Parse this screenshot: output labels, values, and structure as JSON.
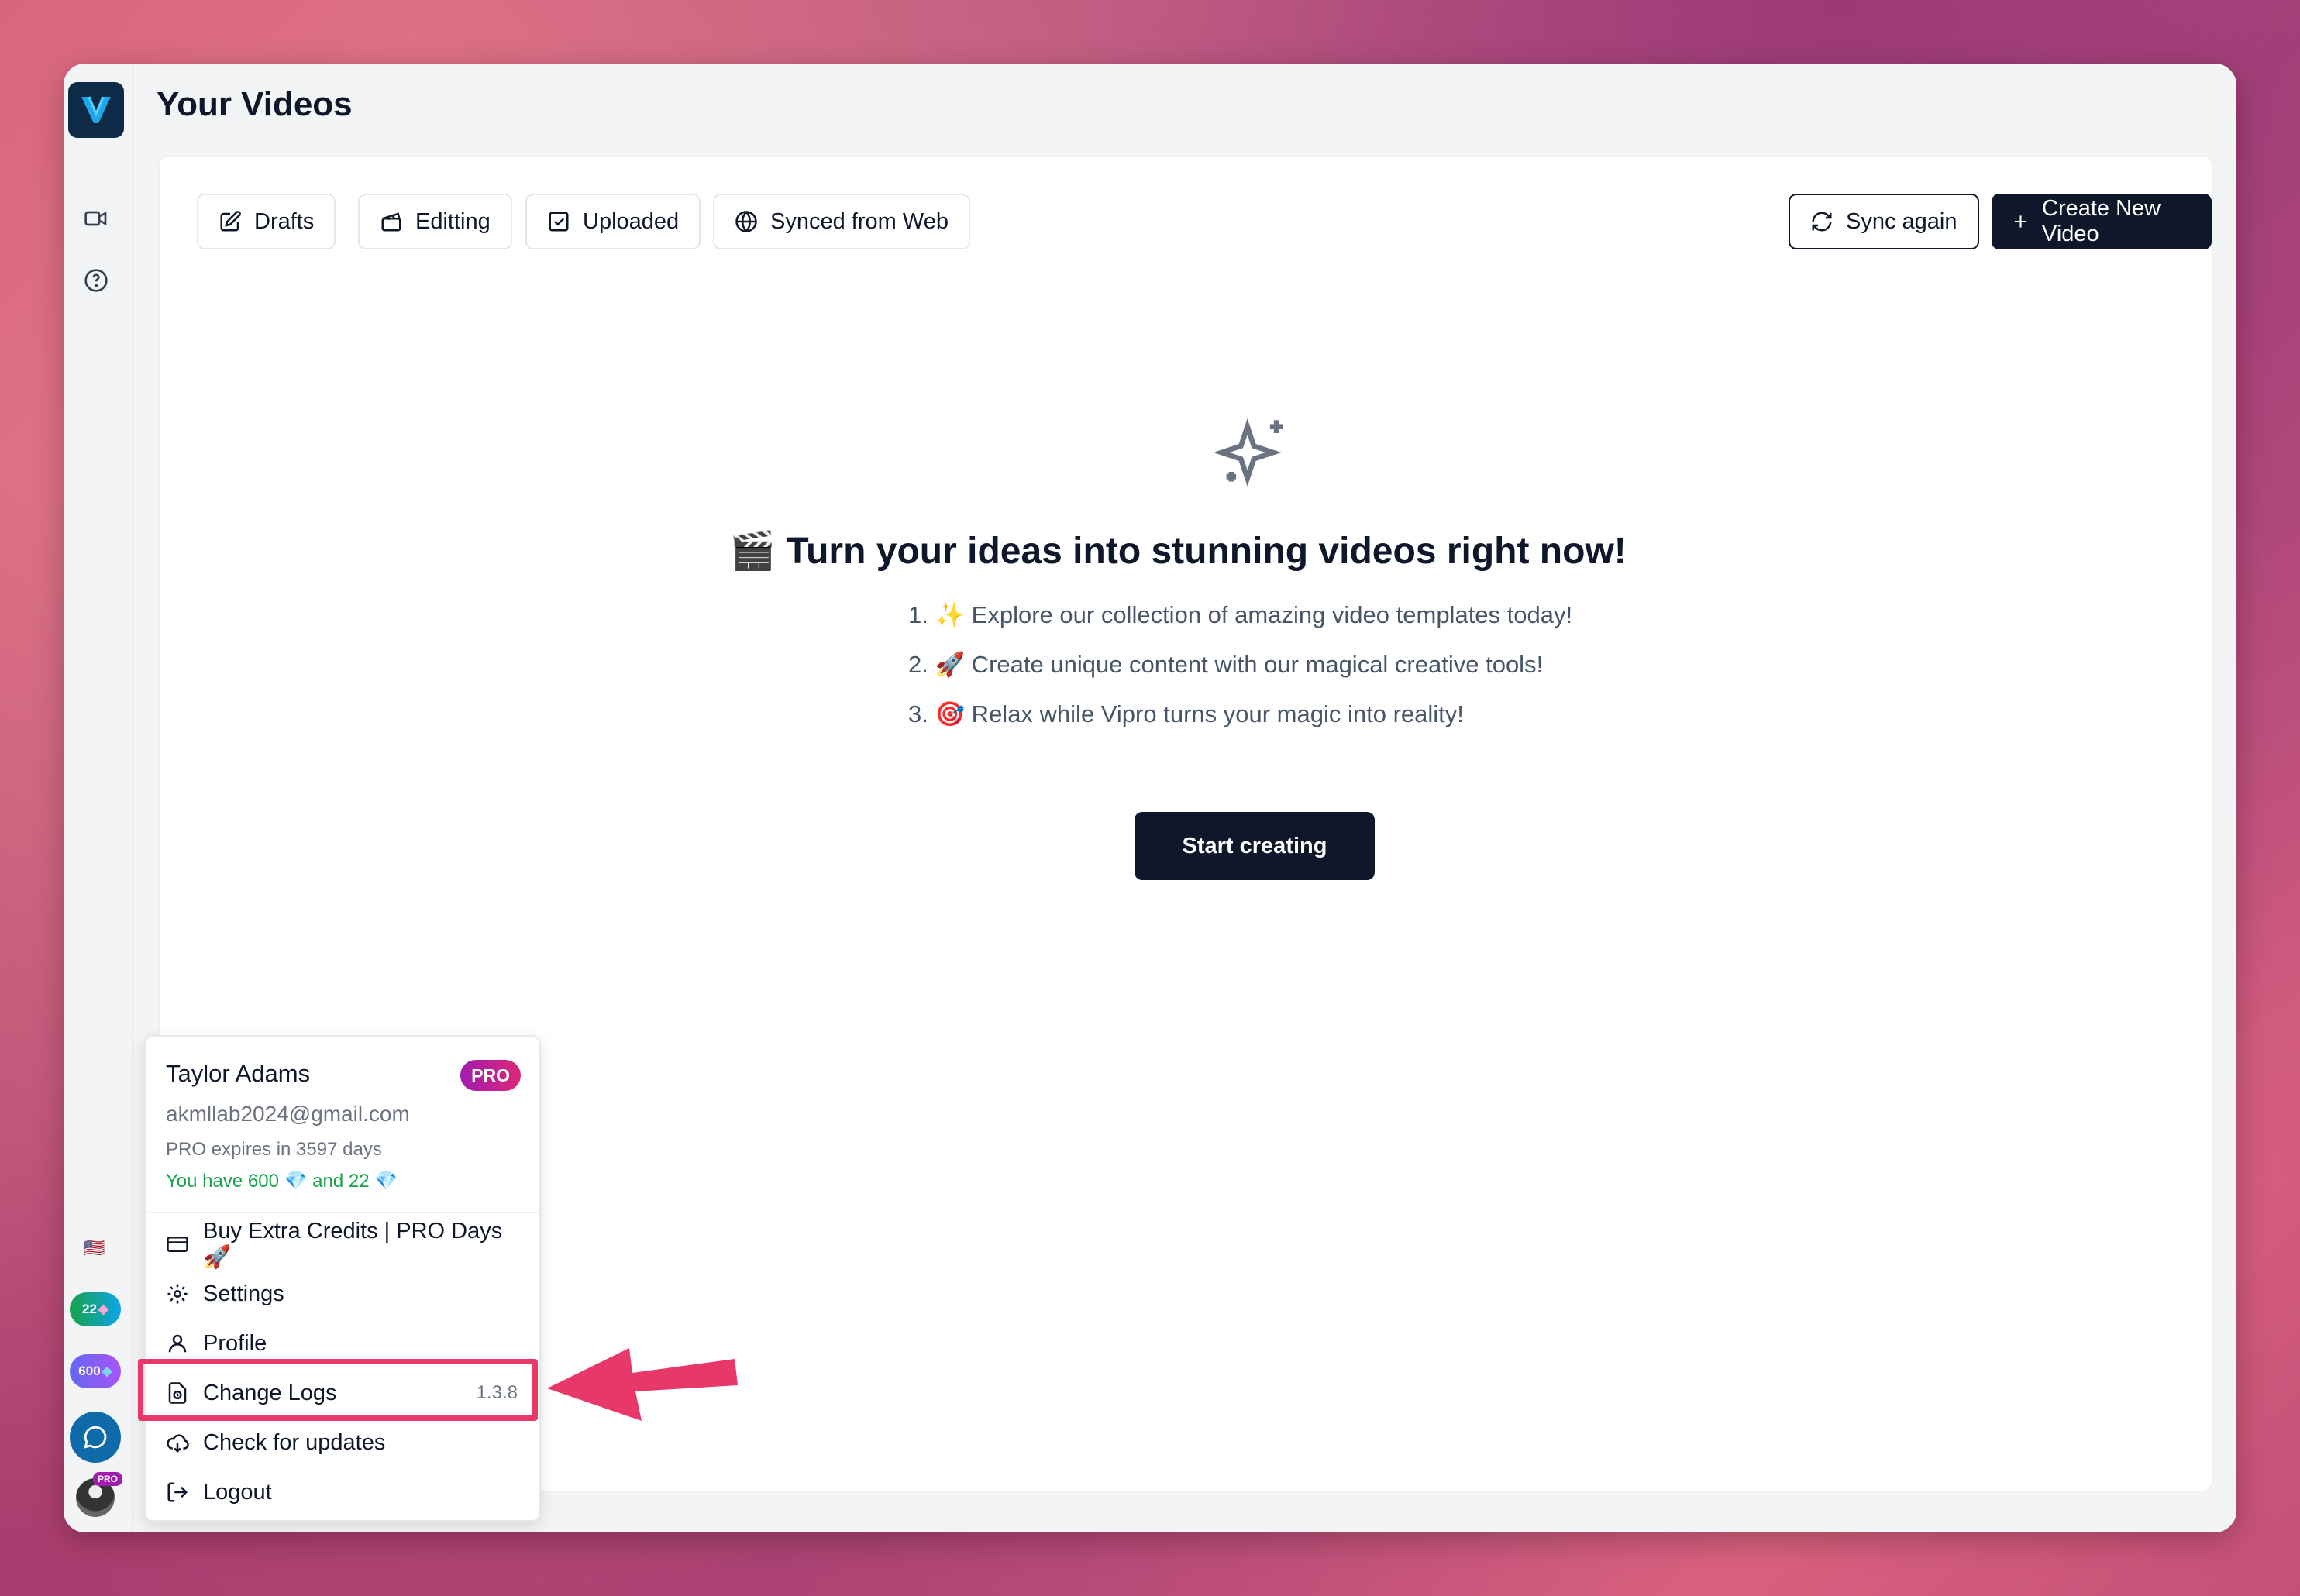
{
  "page": {
    "title": "Your Videos"
  },
  "tabs": [
    {
      "label": "Drafts",
      "icon": "edit-icon"
    },
    {
      "label": "Editting",
      "icon": "clapperboard-icon"
    },
    {
      "label": "Uploaded",
      "icon": "checkbox-icon"
    },
    {
      "label": "Synced from Web",
      "icon": "globe-icon"
    }
  ],
  "actions": {
    "sync_label": "Sync again",
    "create_label": "Create New Video"
  },
  "empty_state": {
    "title": "🎬 Turn your ideas into stunning videos right now!",
    "steps": [
      "1. ✨ Explore our collection of amazing video templates today!",
      "2. 🚀 Create unique content with our magical creative tools!",
      "3. 🎯 Relax while Vipro turns your magic into reality!"
    ],
    "cta_label": "Start creating"
  },
  "sidebar": {
    "flag": "🇺🇸",
    "gem_pink_count": "22",
    "gem_blue_count": "600",
    "avatar_badge": "PRO"
  },
  "user_menu": {
    "name": "Taylor Adams",
    "badge": "PRO",
    "email": "akmllab2024@gmail.com",
    "expires": "PRO expires in 3597 days",
    "credits": "You have 600 💎 and 22 💎",
    "items": [
      {
        "label": "Buy Extra Credits | PRO Days 🚀",
        "icon": "credit-card-icon"
      },
      {
        "label": "Settings",
        "icon": "gear-icon"
      },
      {
        "label": "Profile",
        "icon": "user-icon"
      },
      {
        "label": "Change Logs",
        "icon": "changelog-icon",
        "version": "1.3.8"
      },
      {
        "label": "Check for updates",
        "icon": "cloud-download-icon"
      },
      {
        "label": "Logout",
        "icon": "logout-icon"
      }
    ]
  },
  "colors": {
    "accent": "#0f172a",
    "highlight": "#e8386a",
    "pro": "#a21caf"
  }
}
